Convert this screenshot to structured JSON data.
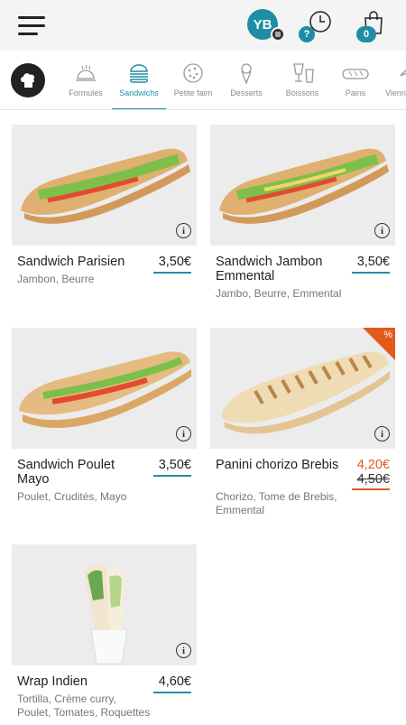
{
  "header": {
    "avatar_initials": "YB",
    "history_badge": "?",
    "cart_count": "0"
  },
  "categories": [
    {
      "label": "Formules",
      "icon": "cloche-icon",
      "active": false
    },
    {
      "label": "Sandwichs",
      "icon": "burger-icon",
      "active": true
    },
    {
      "label": "Petite faim",
      "icon": "cookie-icon",
      "active": false
    },
    {
      "label": "Desserts",
      "icon": "ice-cream-icon",
      "active": false
    },
    {
      "label": "Boissons",
      "icon": "drinks-icon",
      "active": false
    },
    {
      "label": "Pains",
      "icon": "bread-icon",
      "active": false
    },
    {
      "label": "Viennoiseries",
      "icon": "croissant-icon",
      "active": false
    }
  ],
  "products": [
    {
      "name": "Sandwich Parisien",
      "price": "3,50€",
      "description": "Jambon, Beurre"
    },
    {
      "name": "Sandwich Jambon Emmental",
      "price": "3,50€",
      "description": "Jambo, Beurre, Emmental"
    },
    {
      "name": "Sandwich Poulet Mayo",
      "price": "3,50€",
      "description": "Poulet, Crudités, Mayo"
    },
    {
      "name": "Panini chorizo Brebis",
      "price": "4,20€",
      "old_price": "4,50€",
      "promo_label": "%",
      "description": "Chorizo, Tome de Brebis, Emmental"
    },
    {
      "name": "Wrap Indien",
      "price": "4,60€",
      "description": "Tortilla, Crème curry, Poulet, Tomates, Roquettes"
    }
  ],
  "colors": {
    "accent": "#1f8ea5",
    "promo": "#e35a1a"
  }
}
